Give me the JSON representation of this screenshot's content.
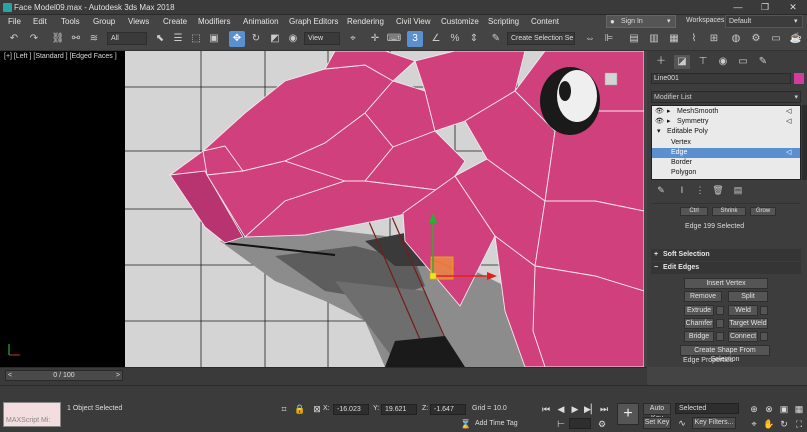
{
  "window": {
    "title": "Face Model09.max - Autodesk 3ds Max 2018",
    "minimize": "—",
    "maximize": "❐",
    "close": "✕"
  },
  "menu": [
    "File",
    "Edit",
    "Tools",
    "Group",
    "Views",
    "Create",
    "Modifiers",
    "Animation",
    "Graph Editors",
    "Rendering",
    "Civil View",
    "Customize",
    "Scripting",
    "Content"
  ],
  "signin": {
    "label": "Sign In"
  },
  "workspace": {
    "label": "Workspaces:",
    "value": "Default"
  },
  "toolbar": {
    "selection_filter": "All",
    "ref_coord": "View",
    "named_sel_placeholder": "Create Selection Se"
  },
  "viewport": {
    "label": "[+] [Left ] [Standard ] [Edged Faces ]"
  },
  "command_panel": {
    "object_name": "Line001",
    "modifier_list_label": "Modifier List",
    "stack": [
      {
        "label": "MeshSmooth",
        "type": "modifier"
      },
      {
        "label": "Symmetry",
        "type": "modifier"
      },
      {
        "label": "Editable Poly",
        "type": "base"
      },
      {
        "label": "Vertex",
        "type": "sub"
      },
      {
        "label": "Edge",
        "type": "sub",
        "selected": true
      },
      {
        "label": "Border",
        "type": "sub"
      },
      {
        "label": "Polygon",
        "type": "sub"
      }
    ],
    "partial_buttons": [
      "Ctrl",
      "Shrink",
      "Grow"
    ],
    "selection_info": "Edge 199 Selected",
    "rollouts": {
      "soft_selection": "Soft Selection",
      "edit_edges": "Edit Edges"
    },
    "edit_edges": {
      "insert_vertex": "Insert Vertex",
      "remove": "Remove",
      "split": "Split",
      "extrude": "Extrude",
      "weld": "Weld",
      "chamfer": "Chamfer",
      "target_weld": "Target Weld",
      "bridge": "Bridge",
      "connect": "Connect",
      "create_shape": "Create Shape From Selection",
      "edge_properties": "Edge Properties"
    }
  },
  "timeline": {
    "frame": "0 / 100",
    "prev": "<",
    "next": ">"
  },
  "status": {
    "maxscript": "MAXScript Mi:",
    "selected": "1 Object Selected",
    "x_label": "X:",
    "x": "-16.023",
    "y_label": "Y:",
    "y": "19.621",
    "z_label": "Z:",
    "z": "-1.647",
    "grid": "Grid = 10.0",
    "add_time_tag": "Add Time Tag",
    "auto_key": "Auto Key",
    "set_key": "Set Key",
    "key_mode": "Selected",
    "key_filters": "Key Filters..."
  },
  "colors": {
    "accent": "#5a8fd0",
    "mesh": "#d0407c",
    "object_color": "#d43aa0"
  }
}
